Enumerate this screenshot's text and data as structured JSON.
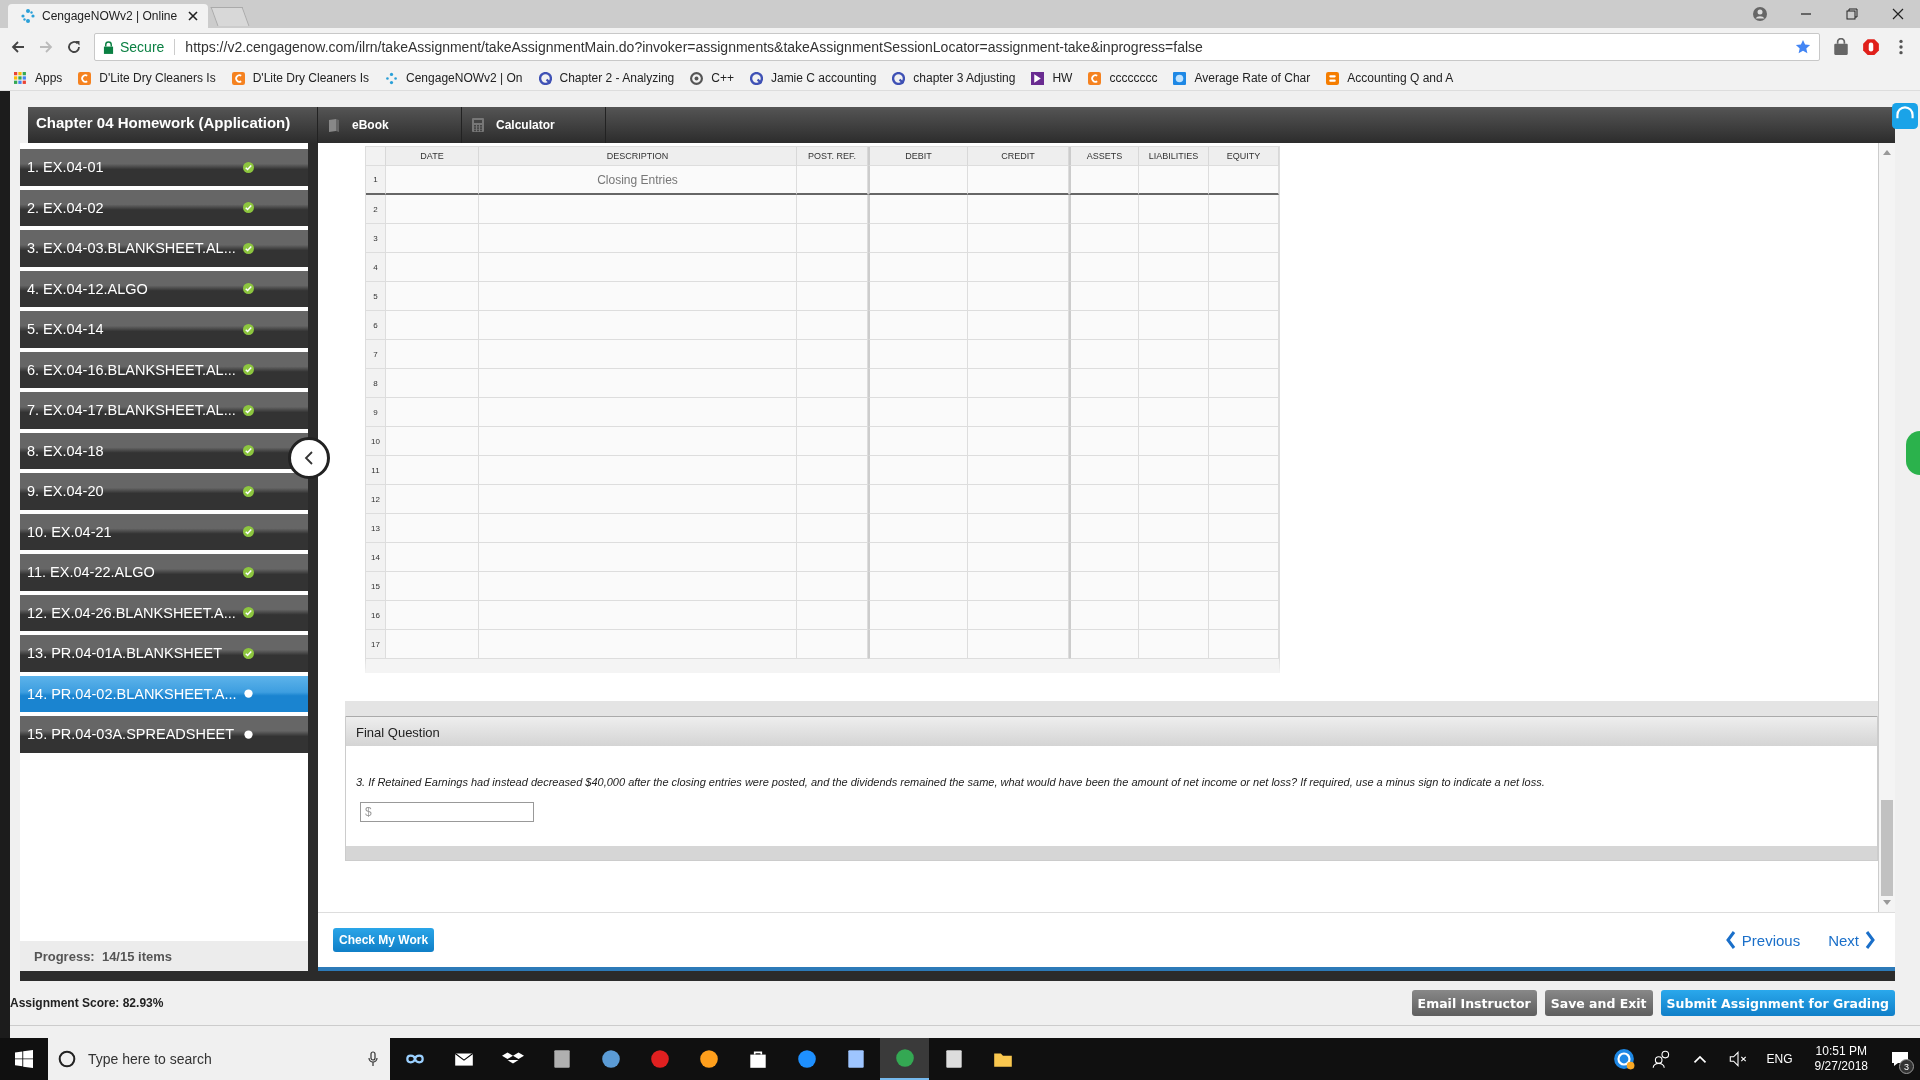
{
  "browser": {
    "tab_title": "CengageNOWv2 | Online",
    "secure_label": "Secure",
    "url": "https://v2.cengagenow.com/ilrn/takeAssignment/takeAssignmentMain.do?invoker=assignments&takeAssignmentSessionLocator=assignment-take&inprogress=false",
    "bookmarks": [
      {
        "label": "Apps",
        "kind": "grid"
      },
      {
        "label": "D'Lite Dry Cleaners Is",
        "kind": "square"
      },
      {
        "label": "D'Lite Dry Cleaners Is",
        "kind": "square"
      },
      {
        "label": "CengageNOWv2 | On",
        "kind": "pinwheel"
      },
      {
        "label": "Chapter 2 - Analyzing",
        "kind": "disc"
      },
      {
        "label": "C++",
        "kind": "ring"
      },
      {
        "label": "Jamie C accounting",
        "kind": "disc"
      },
      {
        "label": "chapter 3 Adjusting",
        "kind": "disc"
      },
      {
        "label": "HW",
        "kind": "chevron"
      },
      {
        "label": "cccccccc",
        "kind": "square"
      },
      {
        "label": "Average Rate of Char",
        "kind": "globe"
      },
      {
        "label": "Accounting Q and A",
        "kind": "blog"
      }
    ]
  },
  "assignment": {
    "title": "Chapter 04 Homework (Application)",
    "tools": [
      {
        "label": "eBook",
        "kind": "book"
      },
      {
        "label": "Calculator",
        "kind": "calculator"
      }
    ]
  },
  "sidebar": {
    "items": [
      {
        "label": "1. EX.04-01",
        "completed": true,
        "selected": false
      },
      {
        "label": "2. EX.04-02",
        "completed": true,
        "selected": false
      },
      {
        "label": "3. EX.04-03.BLANKSHEET.AL...",
        "completed": true,
        "selected": false
      },
      {
        "label": "4. EX.04-12.ALGO",
        "completed": true,
        "selected": false
      },
      {
        "label": "5. EX.04-14",
        "completed": true,
        "selected": false
      },
      {
        "label": "6. EX.04-16.BLANKSHEET.AL...",
        "completed": true,
        "selected": false
      },
      {
        "label": "7. EX.04-17.BLANKSHEET.AL...",
        "completed": true,
        "selected": false
      },
      {
        "label": "8. EX.04-18",
        "completed": true,
        "selected": false
      },
      {
        "label": "9. EX.04-20",
        "completed": true,
        "selected": false
      },
      {
        "label": "10. EX.04-21",
        "completed": true,
        "selected": false
      },
      {
        "label": "11. EX.04-22.ALGO",
        "completed": true,
        "selected": false
      },
      {
        "label": "12. EX.04-26.BLANKSHEET.A...",
        "completed": true,
        "selected": false
      },
      {
        "label": "13. PR.04-01A.BLANKSHEET",
        "completed": true,
        "selected": false
      },
      {
        "label": "14. PR.04-02.BLANKSHEET.A...",
        "completed": false,
        "selected": true
      },
      {
        "label": "15. PR.04-03A.SPREADSHEET",
        "completed": false,
        "selected": false
      }
    ],
    "progress": "Progress:  14/15 items"
  },
  "journal": {
    "columns": [
      "DATE",
      "DESCRIPTION",
      "POST. REF.",
      "DEBIT",
      "CREDIT",
      "ASSETS",
      "LIABILITIES",
      "EQUITY"
    ],
    "rows": [
      {
        "number": "1",
        "description": "Closing Entries"
      },
      {
        "number": "2"
      },
      {
        "number": "3"
      },
      {
        "number": "4"
      },
      {
        "number": "5"
      },
      {
        "number": "6"
      },
      {
        "number": "7"
      },
      {
        "number": "8"
      },
      {
        "number": "9"
      },
      {
        "number": "10"
      },
      {
        "number": "11"
      },
      {
        "number": "12"
      },
      {
        "number": "13"
      },
      {
        "number": "14"
      },
      {
        "number": "15"
      },
      {
        "number": "16"
      },
      {
        "number": "17"
      }
    ]
  },
  "final_question": {
    "heading": "Final Question",
    "text": "3. If Retained Earnings had instead decreased $40,000 after the closing entries were posted, and the dividends remained the same, what would have been the amount of net income or net loss? If required, use a minus sign to indicate a net loss.",
    "answer_placeholder": "$"
  },
  "check_button": "Check My Work",
  "nav": {
    "previous": "Previous",
    "next": "Next"
  },
  "assignment_score": "Assignment Score: 82.93%",
  "actions": [
    {
      "label": "Email Instructor",
      "kind": "secondary"
    },
    {
      "label": "Save and Exit",
      "kind": "secondary"
    },
    {
      "label": "Submit Assignment for Grading",
      "kind": "primary"
    }
  ],
  "taskbar": {
    "search_placeholder": "Type here to search",
    "language": "ENG",
    "time": "10:51 PM",
    "date": "9/27/2018",
    "notification_count": "3"
  }
}
